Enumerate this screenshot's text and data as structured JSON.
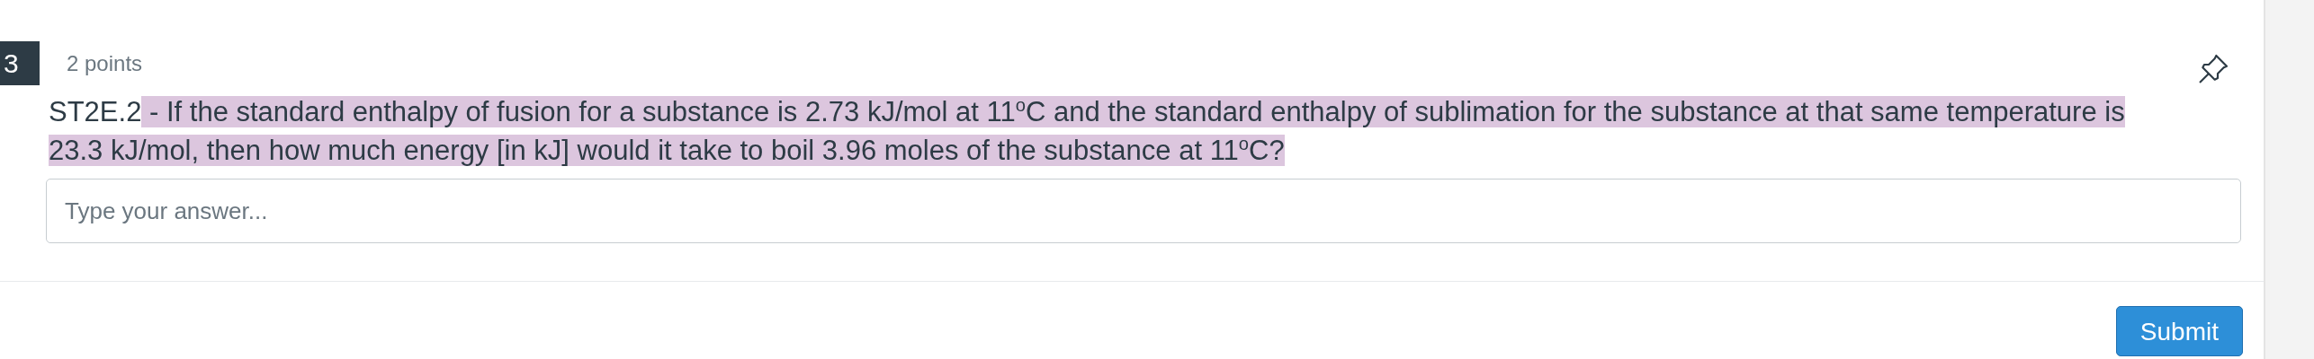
{
  "question": {
    "number": "3",
    "points": "2 points",
    "code": "ST2E.2",
    "text": " - If the standard enthalpy of fusion for a substance is 2.73 kJ/mol at 11$^{o}$C and the standard enthalpy of sublimation for the substance at that same temperature is 23.3 kJ/mol, then how much energy [in kJ] would it take to boil 3.96 moles of the substance at 11$^{o}$C?",
    "text_highlighted": true,
    "answer": {
      "placeholder": "Type your answer..."
    }
  },
  "buttons": [
    "Submit"
  ]
}
